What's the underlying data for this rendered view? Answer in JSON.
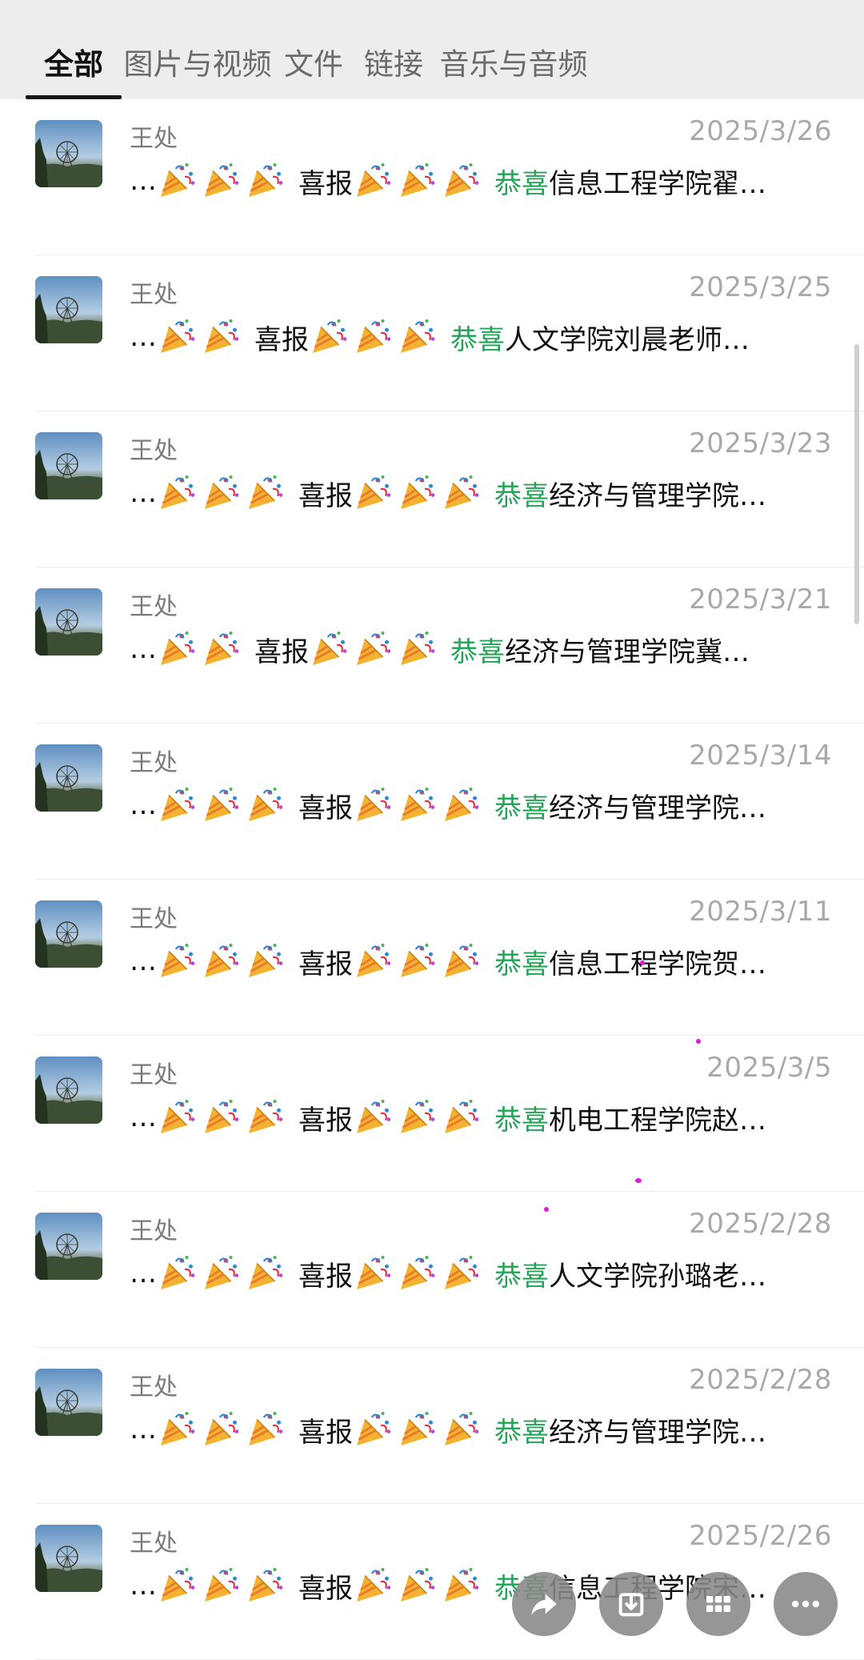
{
  "tabs": [
    {
      "label": "全部",
      "active": true
    },
    {
      "label": "图片与视频",
      "active": false
    },
    {
      "label": "文件",
      "active": false
    },
    {
      "label": "链接",
      "active": false
    },
    {
      "label": "音乐与音频",
      "active": false
    }
  ],
  "messages": [
    {
      "sender": "王处",
      "date": "2025/3/26",
      "prefix": "…",
      "emoji_before": 3,
      "label": "喜报",
      "emoji_after": 3,
      "highlight": "恭喜",
      "text": "信息工程学院翟…"
    },
    {
      "sender": "王处",
      "date": "2025/3/25",
      "prefix": "…",
      "emoji_before": 2,
      "label": "喜报",
      "emoji_after": 3,
      "highlight": "恭喜",
      "text": "人文学院刘晨老师…"
    },
    {
      "sender": "王处",
      "date": "2025/3/23",
      "prefix": "…",
      "emoji_before": 3,
      "label": "喜报",
      "emoji_after": 3,
      "highlight": "恭喜",
      "text": "经济与管理学院…"
    },
    {
      "sender": "王处",
      "date": "2025/3/21",
      "prefix": "…",
      "emoji_before": 2,
      "label": "喜报",
      "emoji_after": 3,
      "highlight": "恭喜",
      "text": "经济与管理学院冀…"
    },
    {
      "sender": "王处",
      "date": "2025/3/14",
      "prefix": "…",
      "emoji_before": 3,
      "label": "喜报",
      "emoji_after": 3,
      "highlight": "恭喜",
      "text": "经济与管理学院…"
    },
    {
      "sender": "王处",
      "date": "2025/3/11",
      "prefix": "…",
      "emoji_before": 3,
      "label": "喜报",
      "emoji_after": 3,
      "highlight": "恭喜",
      "text": "信息工程学院贺…"
    },
    {
      "sender": "王处",
      "date": "2025/3/5",
      "prefix": "…",
      "emoji_before": 3,
      "label": "喜报",
      "emoji_after": 3,
      "highlight": "恭喜",
      "text": "机电工程学院赵…"
    },
    {
      "sender": "王处",
      "date": "2025/2/28",
      "prefix": "…",
      "emoji_before": 3,
      "label": "喜报",
      "emoji_after": 3,
      "highlight": "恭喜",
      "text": "人文学院孙璐老…"
    },
    {
      "sender": "王处",
      "date": "2025/2/28",
      "prefix": "…",
      "emoji_before": 3,
      "label": "喜报",
      "emoji_after": 3,
      "highlight": "恭喜",
      "text": "经济与管理学院…"
    },
    {
      "sender": "王处",
      "date": "2025/2/26",
      "prefix": "…",
      "emoji_before": 3,
      "label": "喜报",
      "emoji_after": 3,
      "highlight": "恭喜",
      "text": "信息工程学院宋…"
    }
  ],
  "icons": {
    "party": "party-popper-icon",
    "avatar": "ferris-wheel-photo",
    "actions": [
      "share-icon",
      "download-icon",
      "grid-icon",
      "more-icon"
    ]
  },
  "colors": {
    "highlight": "#21a455",
    "tabbar_bg": "#ededed",
    "date": "#a9a9a9"
  }
}
